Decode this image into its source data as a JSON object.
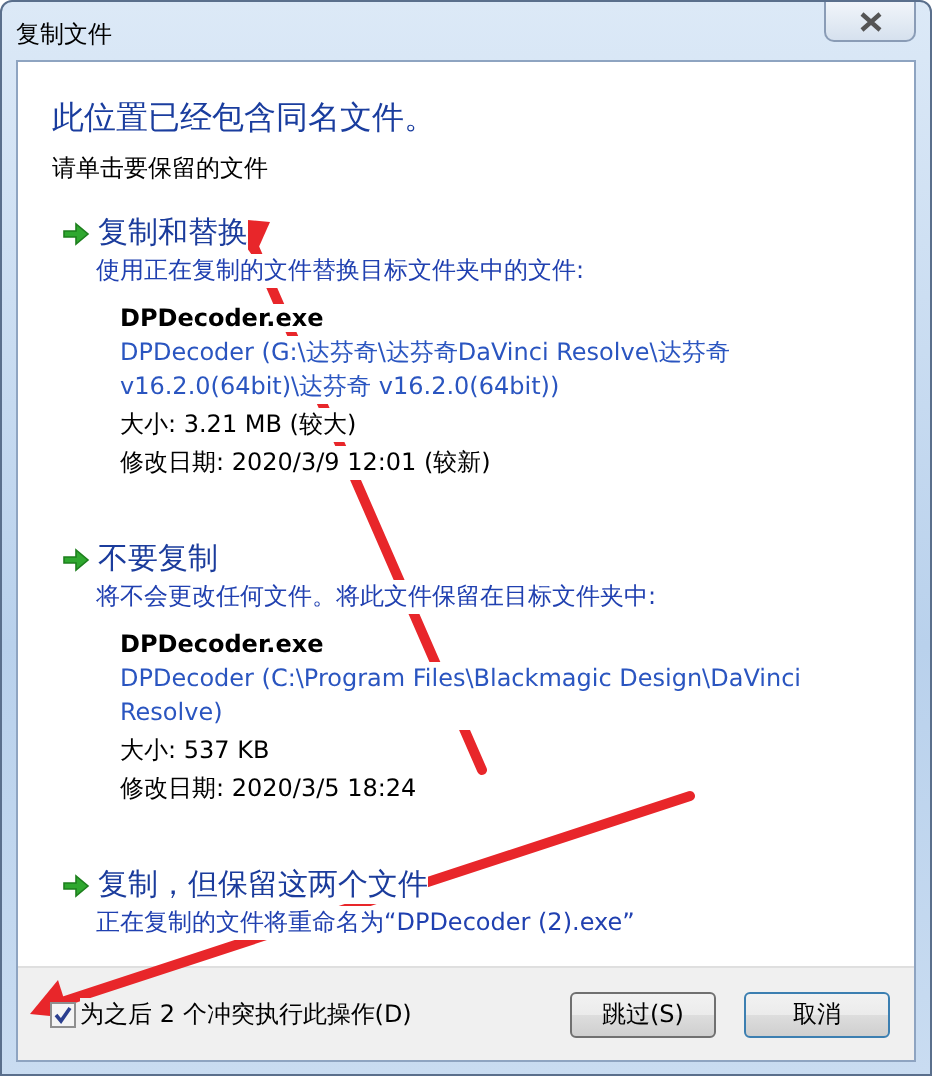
{
  "window": {
    "title": "复制文件"
  },
  "heading": "此位置已经包含同名文件。",
  "instruction": "请单击要保留的文件",
  "options": [
    {
      "title": "复制和替换",
      "description": "使用正在复制的文件替换目标文件夹中的文件:",
      "file": {
        "name": "DPDecoder.exe",
        "location": "DPDecoder (G:\\达芬奇\\达芬奇DaVinci Resolve\\达芬奇 v16.2.0(64bit)\\达芬奇 v16.2.0(64bit))",
        "size": "大小: 3.21 MB (较大)",
        "modified": "修改日期: 2020/3/9 12:01 (较新)"
      }
    },
    {
      "title": "不要复制",
      "description": "将不会更改任何文件。将此文件保留在目标文件夹中:",
      "file": {
        "name": "DPDecoder.exe",
        "location": "DPDecoder (C:\\Program Files\\Blackmagic Design\\DaVinci Resolve)",
        "size": "大小: 537 KB",
        "modified": "修改日期: 2020/3/5 18:24"
      }
    },
    {
      "title": "复制，但保留这两个文件",
      "description": "正在复制的文件将重命名为“DPDecoder (2).exe”"
    }
  ],
  "footer": {
    "checkbox": {
      "label": "为之后 2 个冲突执行此操作(D)",
      "checked": true
    },
    "buttons": [
      "跳过(S)",
      "取消"
    ]
  }
}
